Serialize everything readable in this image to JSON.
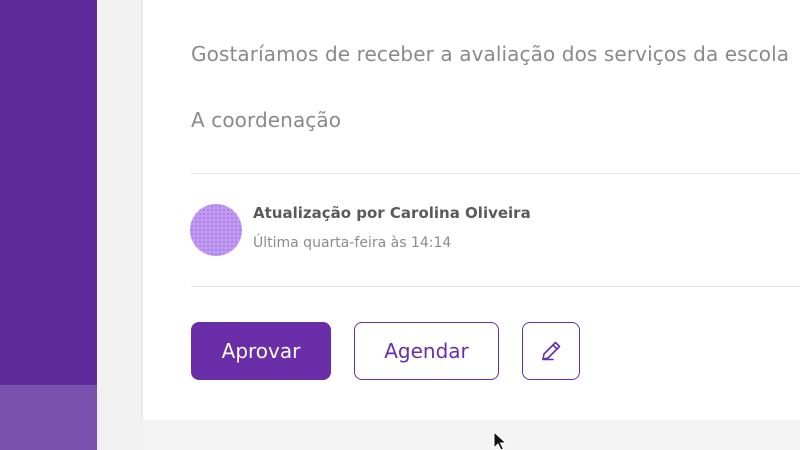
{
  "content": {
    "message_line": "Gostaríamos de receber a avaliação dos serviços da escola",
    "signature": "A coordenação"
  },
  "update": {
    "author_line": "Atualização por Carolina Oliveira",
    "time": "Última quarta-feira às 14:14"
  },
  "actions": {
    "approve_label": "Aprovar",
    "schedule_label": "Agendar",
    "edit_icon": "pencil-icon"
  },
  "colors": {
    "sidebar": "#5f2b9a",
    "accent": "#6a2ea8",
    "avatar": "#c09af0"
  }
}
